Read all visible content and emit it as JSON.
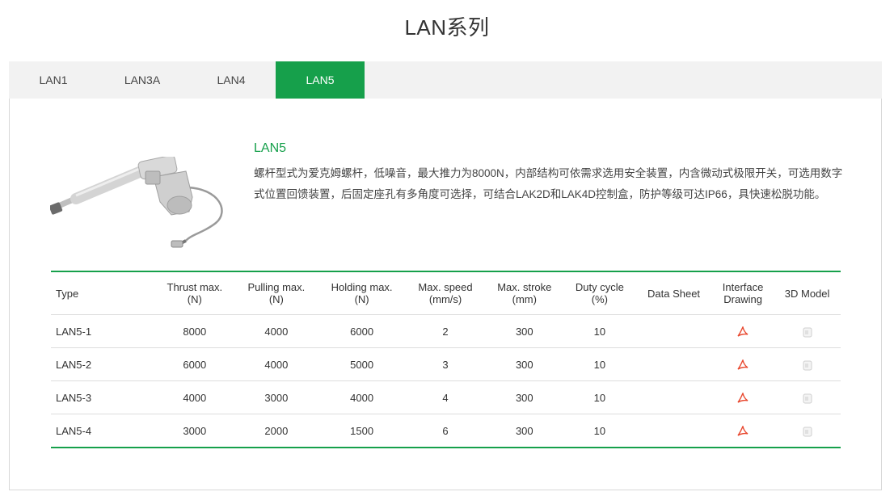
{
  "page": {
    "title": "LAN系列"
  },
  "tabs": [
    {
      "label": "LAN1"
    },
    {
      "label": "LAN3A"
    },
    {
      "label": "LAN4"
    },
    {
      "label": "LAN5"
    }
  ],
  "active_tab": "LAN5",
  "colors": {
    "accent": "#16a04b",
    "tab_bar": "#f2f2f2",
    "pdf_icon": "#e8482f"
  },
  "product": {
    "title": "LAN5",
    "description": "螺杆型式为爱克姆螺杆，低噪音，最大推力为8000N，内部结构可依需求选用安全装置，内含微动式极限开关，可选用数字式位置回馈装置，后固定座孔有多角度可选择，可结合LAK2D和LAK4D控制盒，防护等级可达IP66，具快速松脱功能。"
  },
  "table": {
    "headers": [
      {
        "line1": "Type",
        "line2": ""
      },
      {
        "line1": "Thrust max.",
        "line2": "(N)"
      },
      {
        "line1": "Pulling max.",
        "line2": "(N)"
      },
      {
        "line1": "Holding max.",
        "line2": "(N)"
      },
      {
        "line1": "Max. speed",
        "line2": "(mm/s)"
      },
      {
        "line1": "Max. stroke",
        "line2": "(mm)"
      },
      {
        "line1": "Duty cycle",
        "line2": "(%)"
      },
      {
        "line1": "Data Sheet",
        "line2": ""
      },
      {
        "line1": "Interface",
        "line2": "Drawing"
      },
      {
        "line1": "3D Model",
        "line2": ""
      }
    ],
    "rows": [
      {
        "type": "LAN5-1",
        "thrust": "8000",
        "pulling": "4000",
        "holding": "6000",
        "speed": "2",
        "stroke": "300",
        "duty": "10",
        "data_sheet": "",
        "interface_icon": "pdf-icon",
        "model_icon": "3d-model-icon"
      },
      {
        "type": "LAN5-2",
        "thrust": "6000",
        "pulling": "4000",
        "holding": "5000",
        "speed": "3",
        "stroke": "300",
        "duty": "10",
        "data_sheet": "",
        "interface_icon": "pdf-icon",
        "model_icon": "3d-model-icon"
      },
      {
        "type": "LAN5-3",
        "thrust": "4000",
        "pulling": "3000",
        "holding": "4000",
        "speed": "4",
        "stroke": "300",
        "duty": "10",
        "data_sheet": "",
        "interface_icon": "pdf-icon",
        "model_icon": "3d-model-icon"
      },
      {
        "type": "LAN5-4",
        "thrust": "3000",
        "pulling": "2000",
        "holding": "1500",
        "speed": "6",
        "stroke": "300",
        "duty": "10",
        "data_sheet": "",
        "interface_icon": "pdf-icon",
        "model_icon": "3d-model-icon"
      }
    ]
  }
}
